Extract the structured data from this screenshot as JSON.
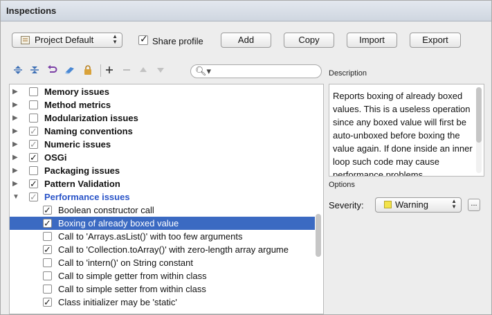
{
  "window": {
    "title": "Inspections"
  },
  "header": {
    "profile_selected": "Project Default",
    "share_profile_label": "Share profile",
    "share_profile_checked": true,
    "buttons": {
      "add": "Add",
      "copy": "Copy",
      "import": "Import",
      "export": "Export"
    }
  },
  "toolbar": {
    "icons": [
      "expand-all-icon",
      "collapse-all-icon",
      "reset-icon",
      "eraser-icon",
      "lock-icon",
      "plus-icon",
      "minus-icon",
      "move-up-icon",
      "move-down-icon"
    ],
    "search_placeholder": ""
  },
  "tree": {
    "rows": [
      {
        "label": "Memory issues",
        "type": "group",
        "checked": false
      },
      {
        "label": "Method metrics",
        "type": "group",
        "checked": false
      },
      {
        "label": "Modularization issues",
        "type": "group",
        "checked": false
      },
      {
        "label": "Naming conventions",
        "type": "group",
        "checked": "partial"
      },
      {
        "label": "Numeric issues",
        "type": "group",
        "checked": "partial"
      },
      {
        "label": "OSGi",
        "type": "group",
        "checked": true
      },
      {
        "label": "Packaging issues",
        "type": "group",
        "checked": false
      },
      {
        "label": "Pattern Validation",
        "type": "group",
        "checked": true
      },
      {
        "label": "Performance issues",
        "type": "group-expanded",
        "checked": "partial"
      },
      {
        "label": "Boolean constructor call",
        "type": "item",
        "checked": true
      },
      {
        "label": "Boxing of already boxed value",
        "type": "item",
        "checked": true,
        "selected": true
      },
      {
        "label": "Call to 'Arrays.asList()' with too few arguments",
        "type": "item",
        "checked": false
      },
      {
        "label": "Call to 'Collection.toArray()' with zero-length array argume",
        "type": "item",
        "checked": true
      },
      {
        "label": "Call to 'intern()' on String constant",
        "type": "item",
        "checked": false
      },
      {
        "label": "Call to simple getter from within class",
        "type": "item",
        "checked": false
      },
      {
        "label": "Call to simple setter from within class",
        "type": "item",
        "checked": false
      },
      {
        "label": "Class initializer may be 'static'",
        "type": "item",
        "checked": true
      }
    ]
  },
  "description": {
    "label": "Description",
    "text": "Reports boxing of already boxed values. This is a useless operation since any boxed value will first be auto-unboxed before boxing the value again. If done inside an inner loop such code may cause performance problems."
  },
  "options": {
    "label": "Options",
    "severity_label": "Severity:",
    "severity_value": "Warning",
    "severity_color": "#f3e34a",
    "more_button": "..."
  },
  "colors": {
    "selection": "#3b6ac2",
    "active_group": "#2a54c8"
  }
}
